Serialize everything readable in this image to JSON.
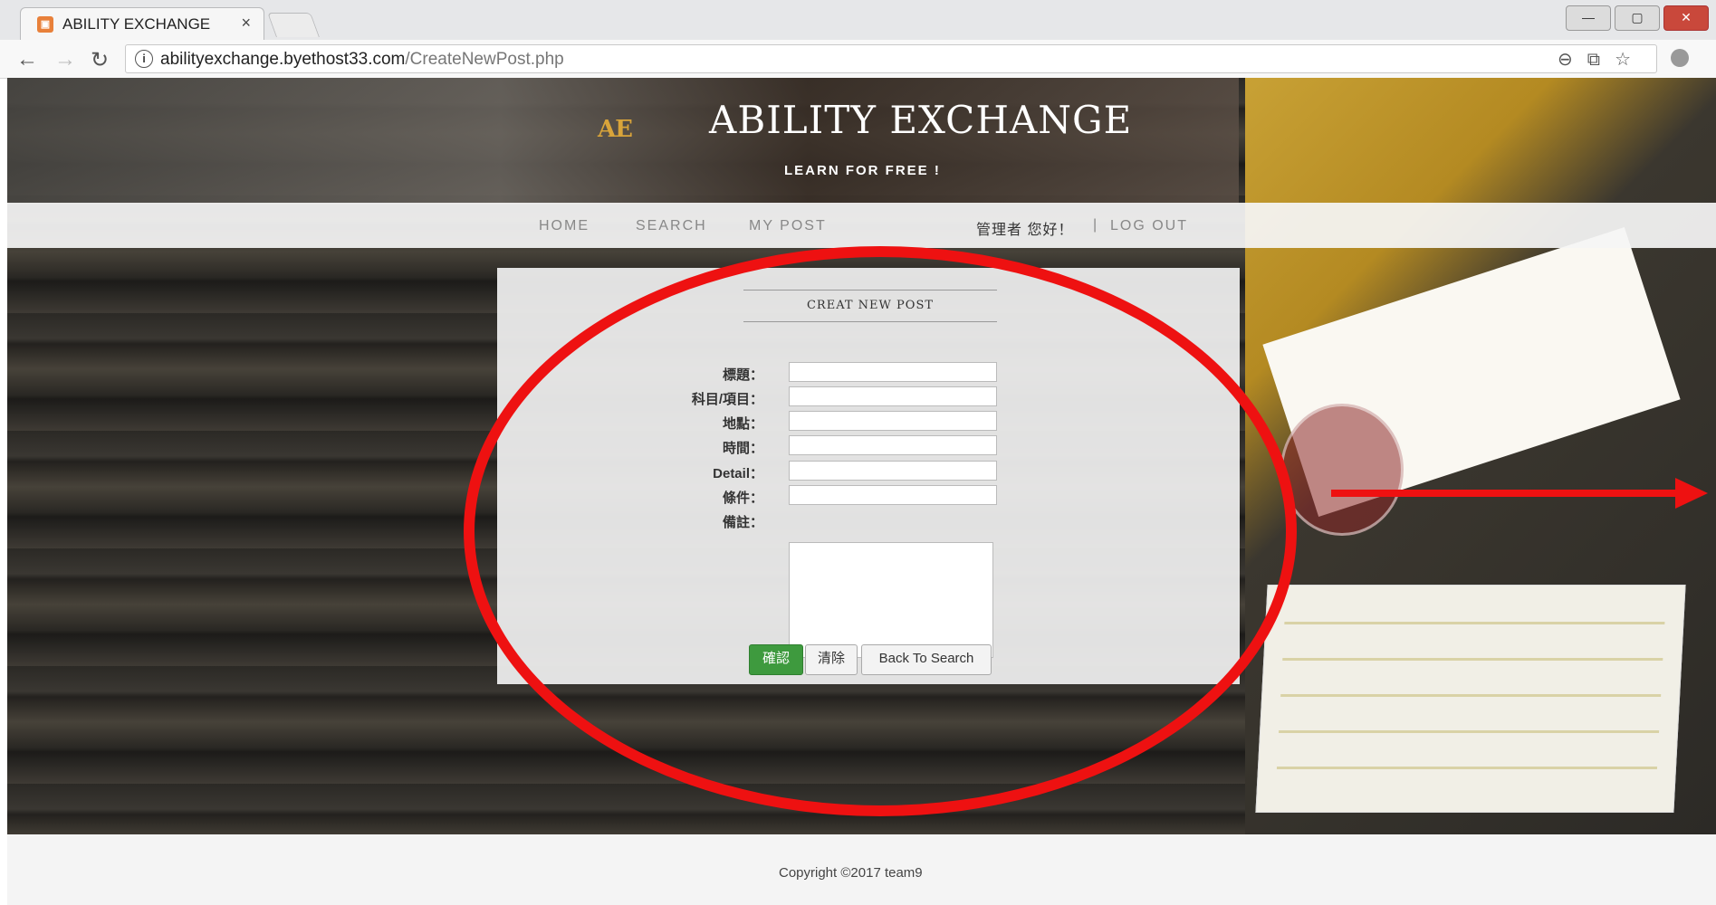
{
  "browser": {
    "tab_title": "ABILITY EXCHANGE",
    "tab_close": "×",
    "url_host": "abilityexchange.byethost33.com",
    "url_path": "/CreateNewPost.php",
    "win_buttons": [
      "—",
      "▢",
      "✕"
    ]
  },
  "header": {
    "logo_text": "AE",
    "title": "ABILITY EXCHANGE",
    "tagline": "LEARN FOR FREE !"
  },
  "nav": {
    "home": "HOME",
    "search": "SEARCH",
    "my_post": "MY POST",
    "greeting": "管理者 您好！",
    "separator": "|",
    "logout": "LOG OUT"
  },
  "form": {
    "title": "CREAT NEW POST",
    "labels": {
      "title": "標題：",
      "subject": "科目/項目：",
      "location": "地點：",
      "time": "時間：",
      "detail": "Detail：",
      "condition": "條件：",
      "remarks": "備註："
    },
    "values": {
      "title": "",
      "subject": "",
      "location": "",
      "time": "",
      "detail": "",
      "condition": "",
      "remarks": ""
    },
    "buttons": {
      "confirm": "確認",
      "clear": "清除",
      "back": "Back To Search"
    }
  },
  "footer": {
    "copyright": "Copyright ©2017 team9"
  },
  "colors": {
    "annotation_red": "#ee1111",
    "confirm_green": "#3e9a3e",
    "logo_gold": "#d9a43a"
  }
}
